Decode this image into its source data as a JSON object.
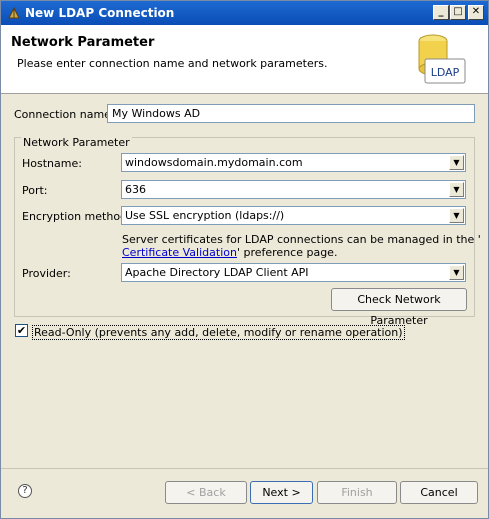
{
  "window": {
    "title": "New LDAP Connection",
    "controls": {
      "minimize": "_",
      "maximize": "□",
      "close": "✕"
    }
  },
  "header": {
    "heading": "Network Parameter",
    "description": "Please enter connection name and network parameters.",
    "logo_text": "LDAP"
  },
  "form": {
    "connection_name_label": "Connection name:",
    "connection_name_value": "My Windows AD",
    "group_label": "Network Parameter",
    "hostname_label": "Hostname:",
    "hostname_value": "windowsdomain.mydomain.com",
    "port_label": "Port:",
    "port_value": "636",
    "encryption_label": "Encryption method:",
    "encryption_value": "Use SSL encryption (ldaps://)",
    "cert_info_before": "Server certificates for LDAP connections can be managed in the '",
    "cert_link": "Certificate Validation",
    "cert_info_after": "' preference page.",
    "provider_label": "Provider:",
    "provider_value": "Apache Directory LDAP Client API",
    "check_button": "Check Network Parameter",
    "readonly_label": "Read-Only (prevents any add, delete, modify or rename operation)",
    "readonly_checked": true
  },
  "footer": {
    "help_icon": "?",
    "back": "< Back",
    "next": "Next >",
    "finish": "Finish",
    "cancel": "Cancel"
  }
}
